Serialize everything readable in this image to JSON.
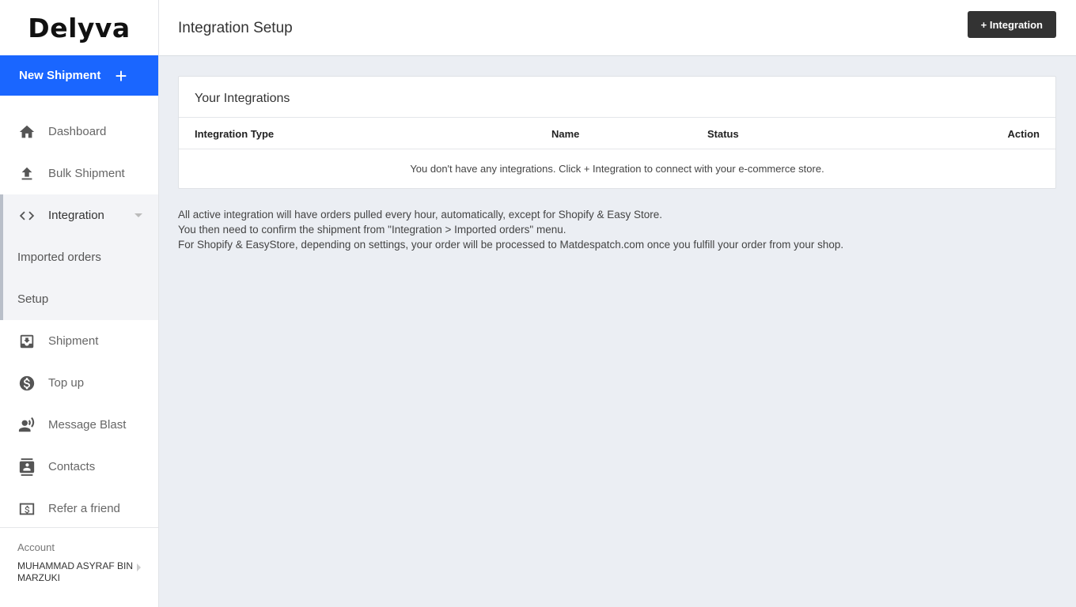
{
  "brand": {
    "logo_text": "Delyva"
  },
  "sidebar": {
    "new_shipment_label": "New Shipment",
    "new_shipment_icon": "+",
    "items": [
      {
        "label": "Dashboard",
        "icon": "home-icon"
      },
      {
        "label": "Bulk Shipment",
        "icon": "upload-icon"
      },
      {
        "label": "Integration",
        "icon": "code-icon"
      },
      {
        "label": "Imported orders"
      },
      {
        "label": "Setup"
      },
      {
        "label": "Shipment",
        "icon": "inbox-icon"
      },
      {
        "label": "Top up",
        "icon": "dollar-icon"
      },
      {
        "label": "Message Blast",
        "icon": "voice-icon"
      },
      {
        "label": "Contacts",
        "icon": "contacts-icon"
      },
      {
        "label": "Refer a friend",
        "icon": "money-icon"
      }
    ],
    "account": {
      "label": "Account",
      "name": "MUHAMMAD ASYRAF BIN MARZUKI"
    }
  },
  "header": {
    "title": "Integration Setup",
    "add_button_label": "+ Integration"
  },
  "integrations_card": {
    "title": "Your Integrations",
    "columns": [
      "Integration Type",
      "Name",
      "Status",
      "Action"
    ],
    "empty_message": "You don't have any integrations. Click + Integration to connect with your e-commerce store."
  },
  "notes": [
    "All active integration will have orders pulled every hour, automatically, except for Shopify & Easy Store.",
    "You then need to confirm the shipment from \"Integration > Imported orders\" menu.",
    "For Shopify & EasyStore, depending on settings, your order will be processed to Matdespatch.com once you fulfill your order from your shop."
  ],
  "colors": {
    "accent": "#1a66ff",
    "button_dark": "#333333",
    "background": "#ebeef3"
  }
}
